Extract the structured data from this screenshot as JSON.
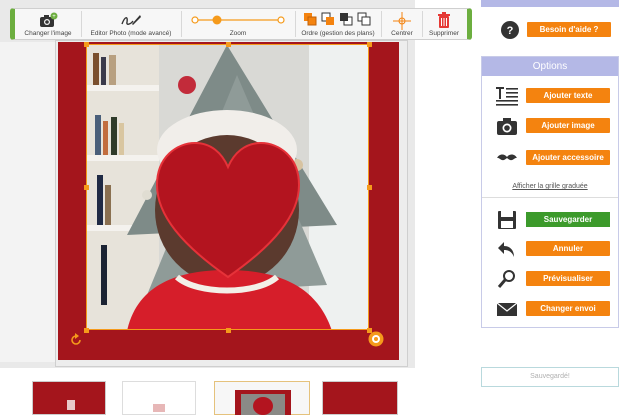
{
  "toolbar": {
    "change_image": "Changer l'image",
    "editor_photo": "Editor Photo (mode avancé)",
    "zoom": "Zoom",
    "order": "Ordre (gestion des plans)",
    "center": "Centrer",
    "delete": "Supprimer"
  },
  "help": {
    "label": "Besoin d'aide ?"
  },
  "options": {
    "title": "Options",
    "add_text": "Ajouter texte",
    "add_image": "Ajouter image",
    "add_accessory": "Ajouter accessoire",
    "show_grid": "Afficher la grille graduée",
    "save": "Sauvegarder",
    "cancel": "Annuler",
    "preview": "Prévisualiser",
    "send": "Changer envoi"
  },
  "status": {
    "saved": "Sauvegardé!"
  },
  "colors": {
    "accent": "#f4830f",
    "toolbar_green": "#6cae3f",
    "card_red": "#a4151c",
    "panel_lavender": "#b4b8e6",
    "save_green": "#3c9a2b"
  },
  "icons": [
    "camera-icon",
    "signature-pen-icon",
    "layers-icon",
    "crosshair-icon",
    "trash-icon",
    "question-icon",
    "text-lines-icon",
    "mustache-icon",
    "floppy-icon",
    "undo-arrow-icon",
    "magnifier-icon",
    "envelope-icon"
  ]
}
